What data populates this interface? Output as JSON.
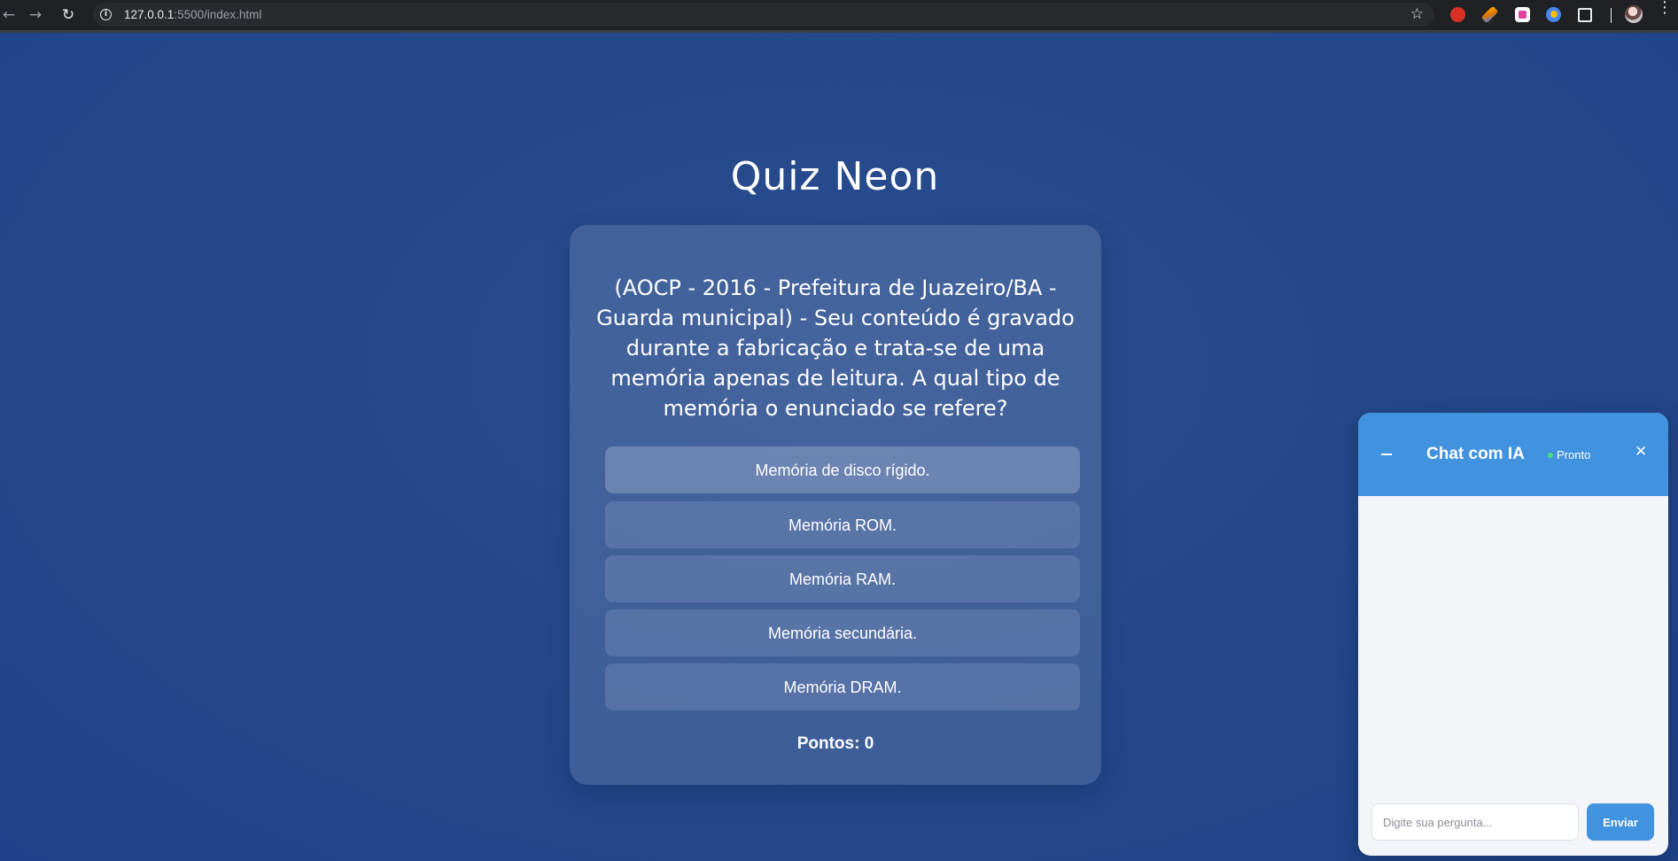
{
  "browser": {
    "url_host": "127.0.0.1",
    "url_path": ":5500/index.html",
    "back_icon": "←",
    "forward_icon": "→",
    "reload_icon": "↻",
    "star_icon": "☆",
    "menu_icon": "⋮"
  },
  "quiz": {
    "title": "Quiz Neon",
    "question": "(AOCP - 2016 - Prefeitura de Juazeiro/BA - Guarda municipal) - Seu conteúdo é gravado durante a fabricação e trata-se de uma memória apenas de leitura. A qual tipo de memória o enunciado se refere?",
    "options": [
      "Memória de disco rígido.",
      "Memória ROM.",
      "Memória RAM.",
      "Memória secundária.",
      "Memória DRAM."
    ],
    "score_label": "Pontos: 0"
  },
  "chat": {
    "title": "Chat com IA",
    "status": "Pronto",
    "close_icon": "✕",
    "input_placeholder": "Digite sua pergunta...",
    "send_label": "Enviar"
  },
  "colors": {
    "background": "#22478a",
    "chat_accent": "#4193df",
    "status_green": "#4ade80"
  }
}
